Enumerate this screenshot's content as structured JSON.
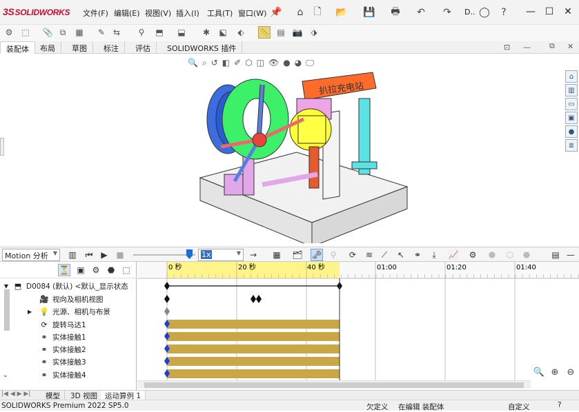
{
  "app": {
    "logo_text": "SOLIDWORKS",
    "logo_prefix": "3S"
  },
  "menu": [
    "文件(F)",
    "编辑(E)",
    "视图(V)",
    "插入(I)",
    "工具(T)",
    "窗口(W)"
  ],
  "title_truncated": "D..",
  "tabs": [
    "装配体",
    "布局",
    "草图",
    "标注",
    "评估",
    "SOLIDWORKS 插件"
  ],
  "model": {
    "banner_text": "扒拉充电站"
  },
  "motion": {
    "study_type": "Motion 分析",
    "speed": "1x",
    "timeline_ticks": [
      "0 秒",
      "20 秒",
      "40 秒",
      "01:00",
      "01:20",
      "01:40"
    ]
  },
  "tree": {
    "root": "D0084 (默认) <默认_显示状态",
    "items": [
      "视向及相机视图",
      "光源、相机与布景",
      "旋转马达1",
      "实体接触1",
      "实体接触2",
      "实体接触3",
      "实体接触4"
    ]
  },
  "bottom_tabs": [
    "模型",
    "3D 视图",
    "运动算例 1"
  ],
  "status": {
    "product": "SOLIDWORKS Premium 2022 SP5.0",
    "state1": "欠定义",
    "state2": "在编辑 装配体",
    "units": "自定义"
  },
  "colors": {
    "accent": "#c8102e",
    "timebar": "#c9a646",
    "key": "#1a3fd6",
    "highlight": "#fff48a"
  }
}
